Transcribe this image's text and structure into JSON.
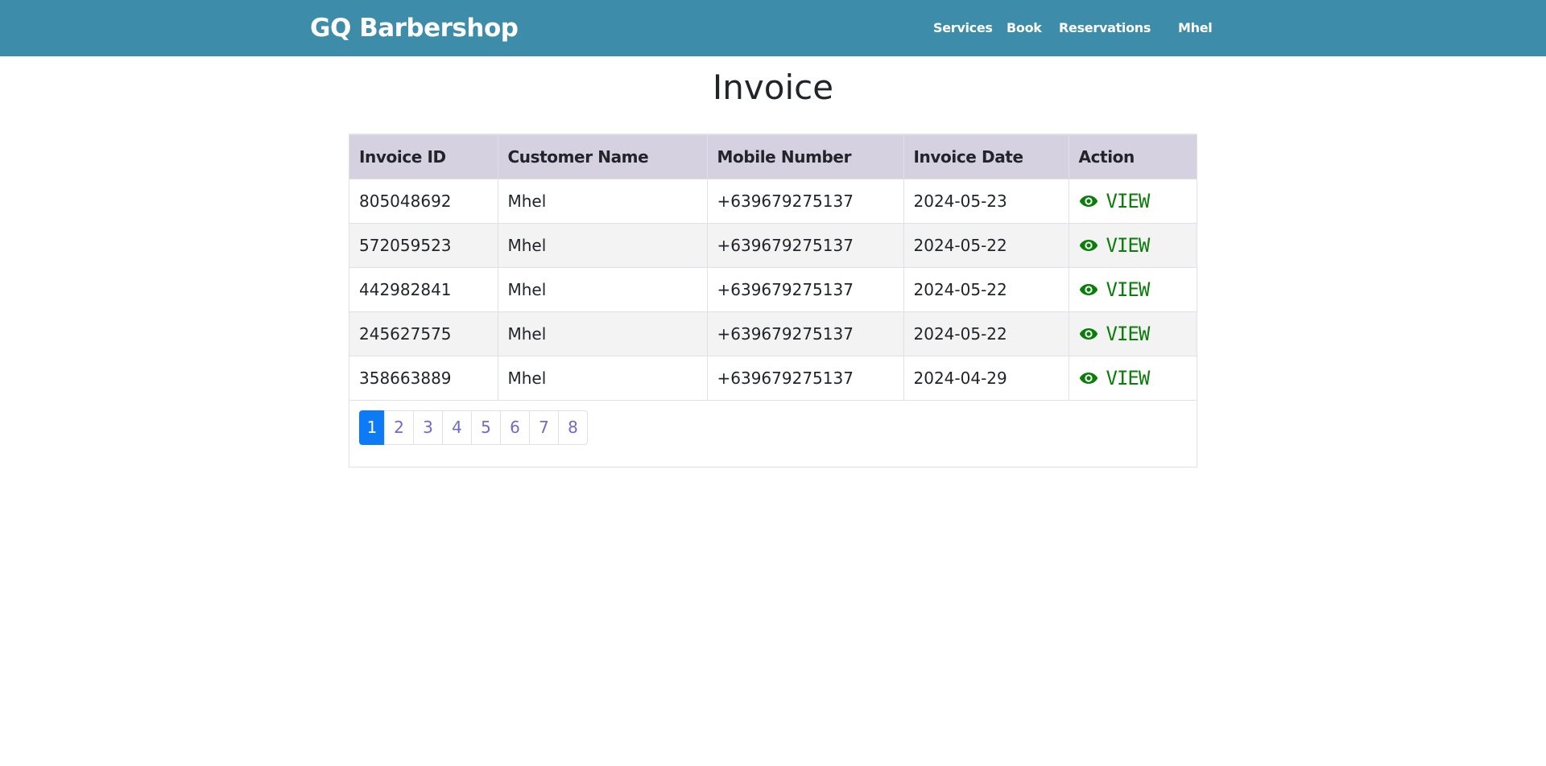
{
  "navbar": {
    "brand": "GQ Barbershop",
    "links": [
      "Services",
      "Book",
      "Reservations"
    ],
    "user": "Mhel"
  },
  "page": {
    "title": "Invoice"
  },
  "table": {
    "headers": [
      "Invoice ID",
      "Customer Name",
      "Mobile Number",
      "Invoice Date",
      "Action"
    ],
    "rows": [
      {
        "id": "805048692",
        "name": "Mhel",
        "mobile": "+639679275137",
        "date": "2024-05-23",
        "action": "VIEW"
      },
      {
        "id": "572059523",
        "name": "Mhel",
        "mobile": "+639679275137",
        "date": "2024-05-22",
        "action": "VIEW"
      },
      {
        "id": "442982841",
        "name": "Mhel",
        "mobile": "+639679275137",
        "date": "2024-05-22",
        "action": "VIEW"
      },
      {
        "id": "245627575",
        "name": "Mhel",
        "mobile": "+639679275137",
        "date": "2024-05-22",
        "action": "VIEW"
      },
      {
        "id": "358663889",
        "name": "Mhel",
        "mobile": "+639679275137",
        "date": "2024-04-29",
        "action": "VIEW"
      }
    ],
    "action_icon": "eye-icon"
  },
  "pagination": {
    "pages": [
      "1",
      "2",
      "3",
      "4",
      "5",
      "6",
      "7",
      "8"
    ],
    "current": "1"
  },
  "colors": {
    "navbar_bg": "#3d8ca9",
    "header_bg": "#d6d1e0",
    "view_link": "#0a7d0a",
    "active_page": "#0d7bf5",
    "page_link": "#6f6acb"
  }
}
